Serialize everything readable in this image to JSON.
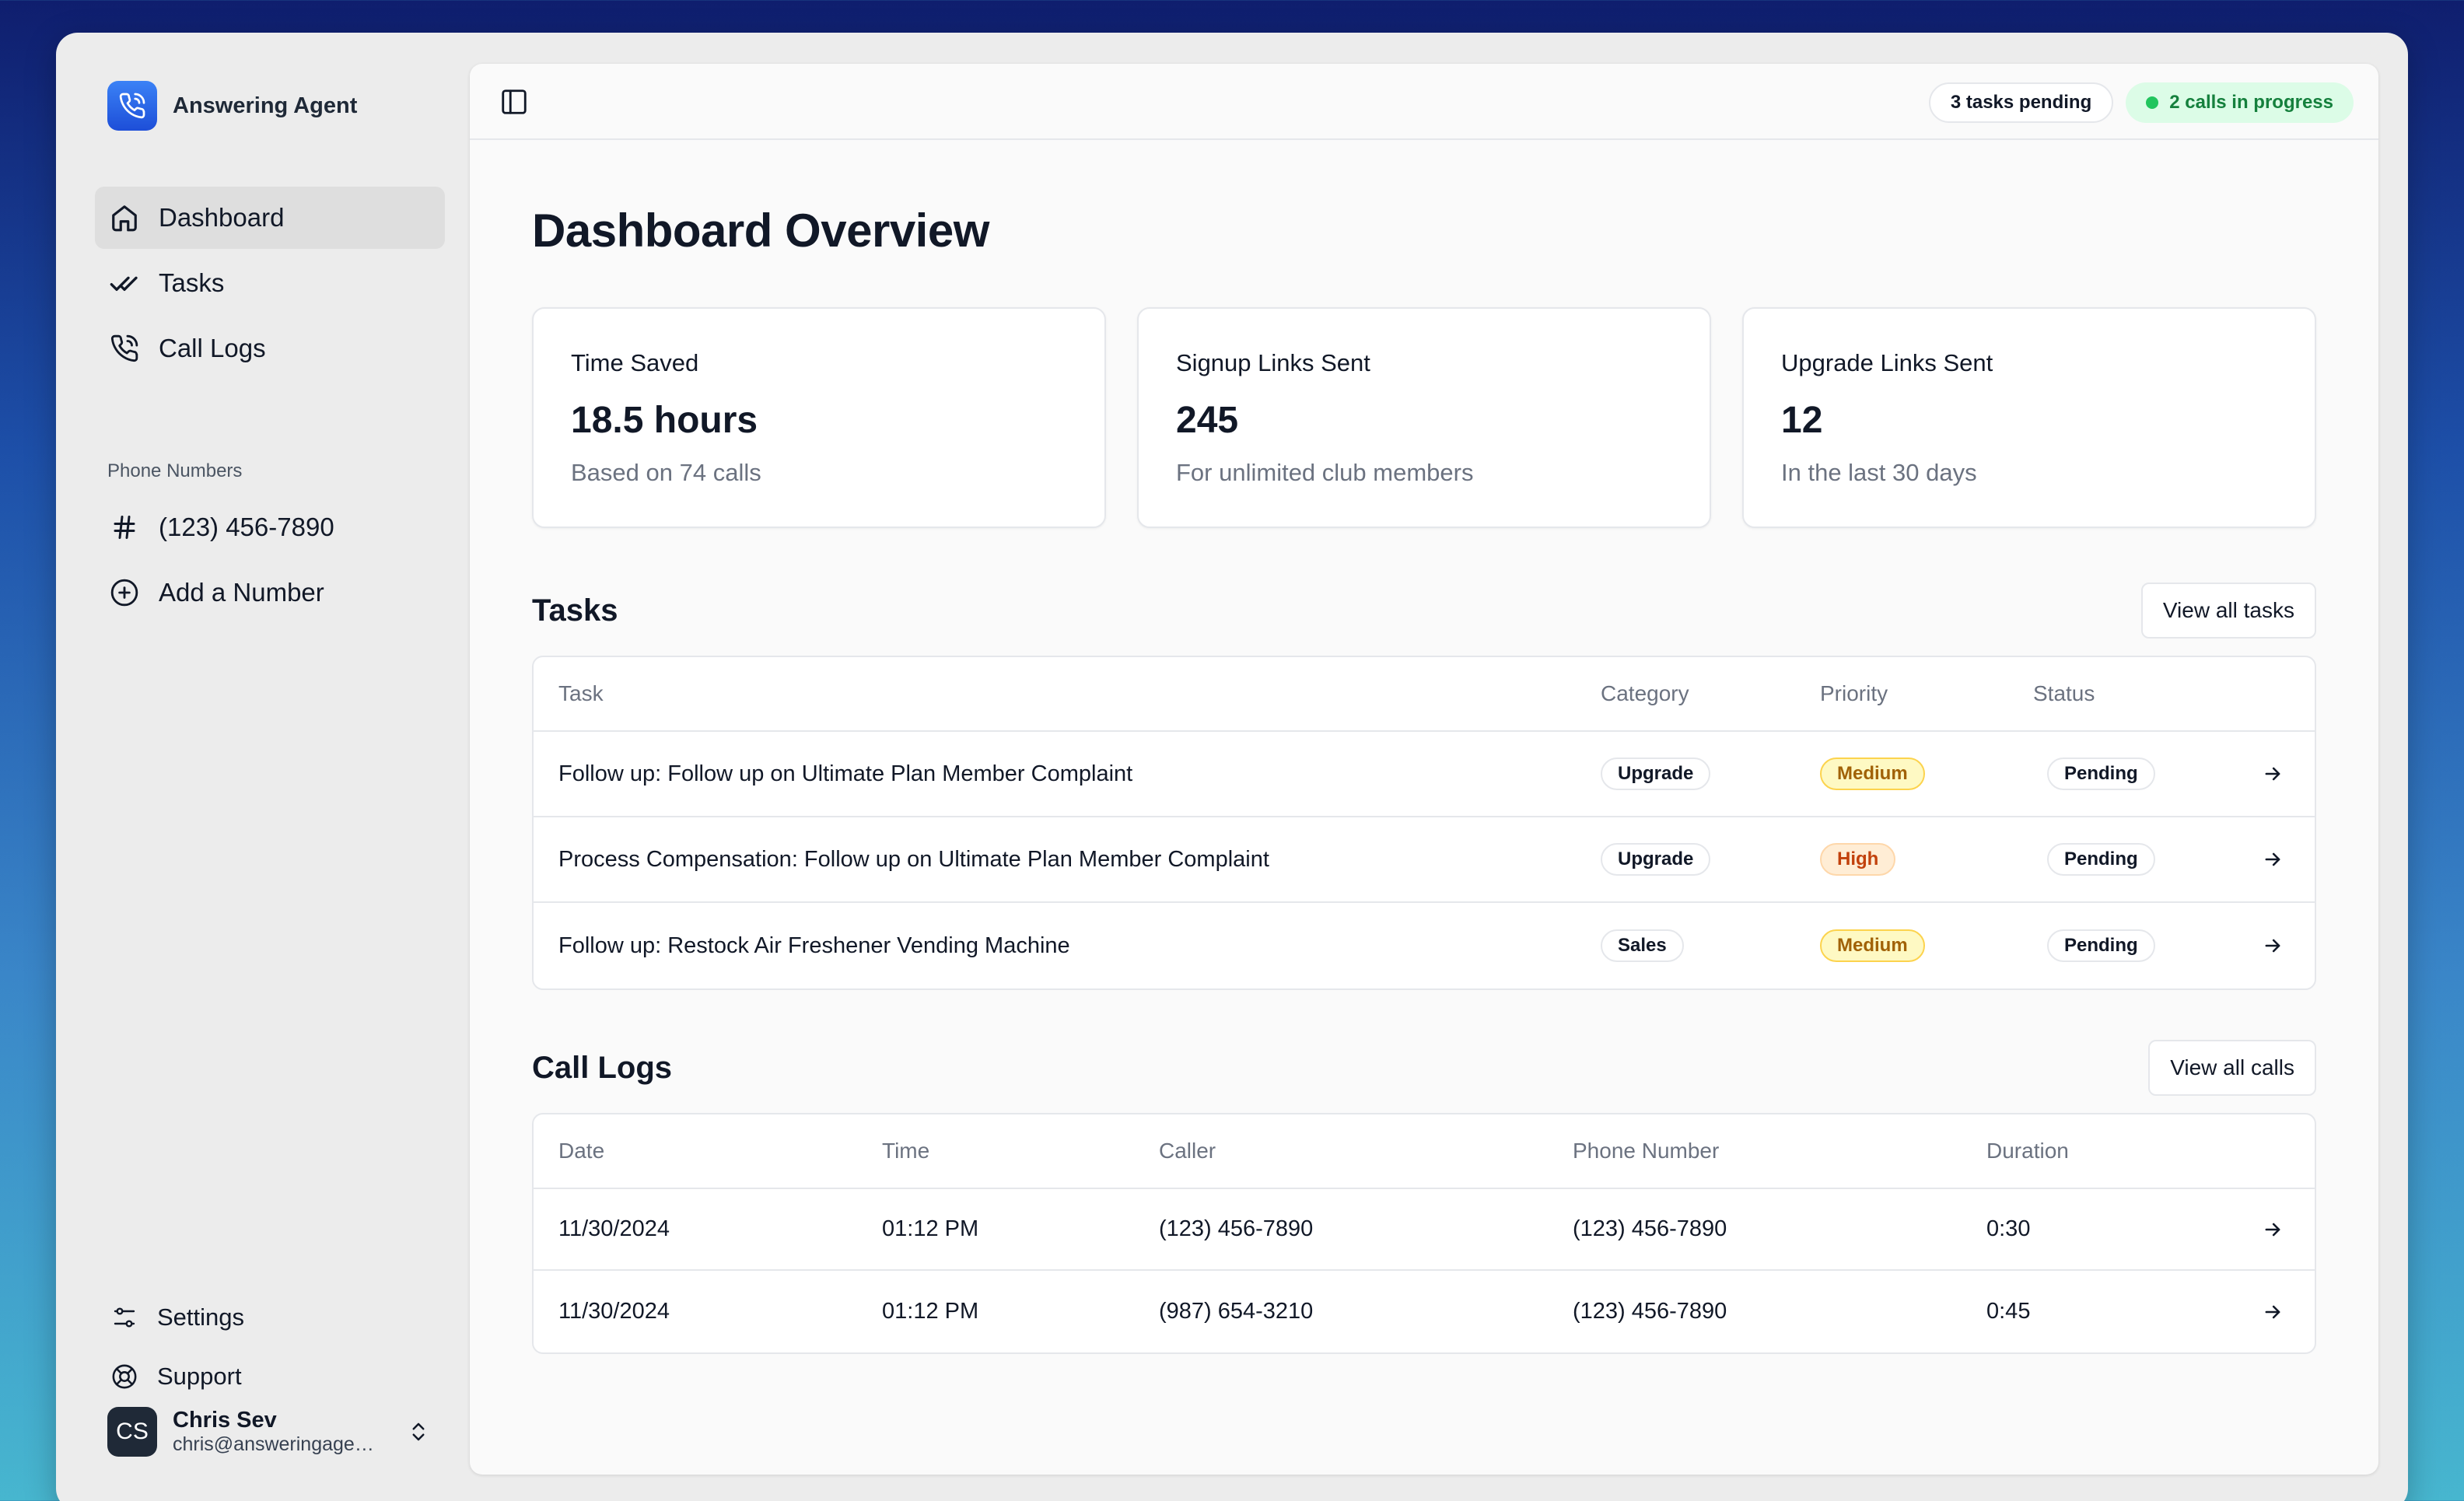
{
  "app": {
    "name": "Answering Agent"
  },
  "sidebar": {
    "nav": [
      {
        "label": "Dashboard",
        "icon": "home-icon",
        "active": true
      },
      {
        "label": "Tasks",
        "icon": "double-check-icon"
      },
      {
        "label": "Call Logs",
        "icon": "phone-call-icon"
      }
    ],
    "phone_section_label": "Phone Numbers",
    "phone_numbers": [
      {
        "label": "(123) 456-7890",
        "icon": "hash-icon"
      }
    ],
    "add_number_label": "Add a Number",
    "footer": [
      {
        "label": "Settings",
        "icon": "sliders-icon"
      },
      {
        "label": "Support",
        "icon": "lifebuoy-icon"
      }
    ],
    "user": {
      "initials": "CS",
      "name": "Chris Sev",
      "email": "chris@answeringagent.com"
    }
  },
  "topbar": {
    "tasks_pending": "3 tasks pending",
    "calls_in_progress": "2 calls in progress",
    "status_color": "#22c55e"
  },
  "page": {
    "title": "Dashboard Overview"
  },
  "stats": [
    {
      "label": "Time Saved",
      "value": "18.5 hours",
      "sub": "Based on 74 calls"
    },
    {
      "label": "Signup Links Sent",
      "value": "245",
      "sub": "For unlimited club members"
    },
    {
      "label": "Upgrade Links Sent",
      "value": "12",
      "sub": "In the last 30 days"
    }
  ],
  "tasks": {
    "title": "Tasks",
    "view_all_label": "View all tasks",
    "columns": [
      "Task",
      "Category",
      "Priority",
      "Status"
    ],
    "rows": [
      {
        "task": "Follow up: Follow up on Ultimate Plan Member Complaint",
        "category": "Upgrade",
        "priority": "Medium",
        "status": "Pending"
      },
      {
        "task": "Process Compensation: Follow up on Ultimate Plan Member Complaint",
        "category": "Upgrade",
        "priority": "High",
        "status": "Pending"
      },
      {
        "task": "Follow up: Restock Air Freshener Vending Machine",
        "category": "Sales",
        "priority": "Medium",
        "status": "Pending"
      }
    ]
  },
  "calls": {
    "title": "Call Logs",
    "view_all_label": "View all calls",
    "columns": [
      "Date",
      "Time",
      "Caller",
      "Phone Number",
      "Duration"
    ],
    "rows": [
      {
        "date": "11/30/2024",
        "time": "01:12 PM",
        "caller": "(123) 456-7890",
        "phone": "(123) 456-7890",
        "duration": "0:30"
      },
      {
        "date": "11/30/2024",
        "time": "01:12 PM",
        "caller": "(987) 654-3210",
        "phone": "(123) 456-7890",
        "duration": "0:45"
      }
    ]
  }
}
